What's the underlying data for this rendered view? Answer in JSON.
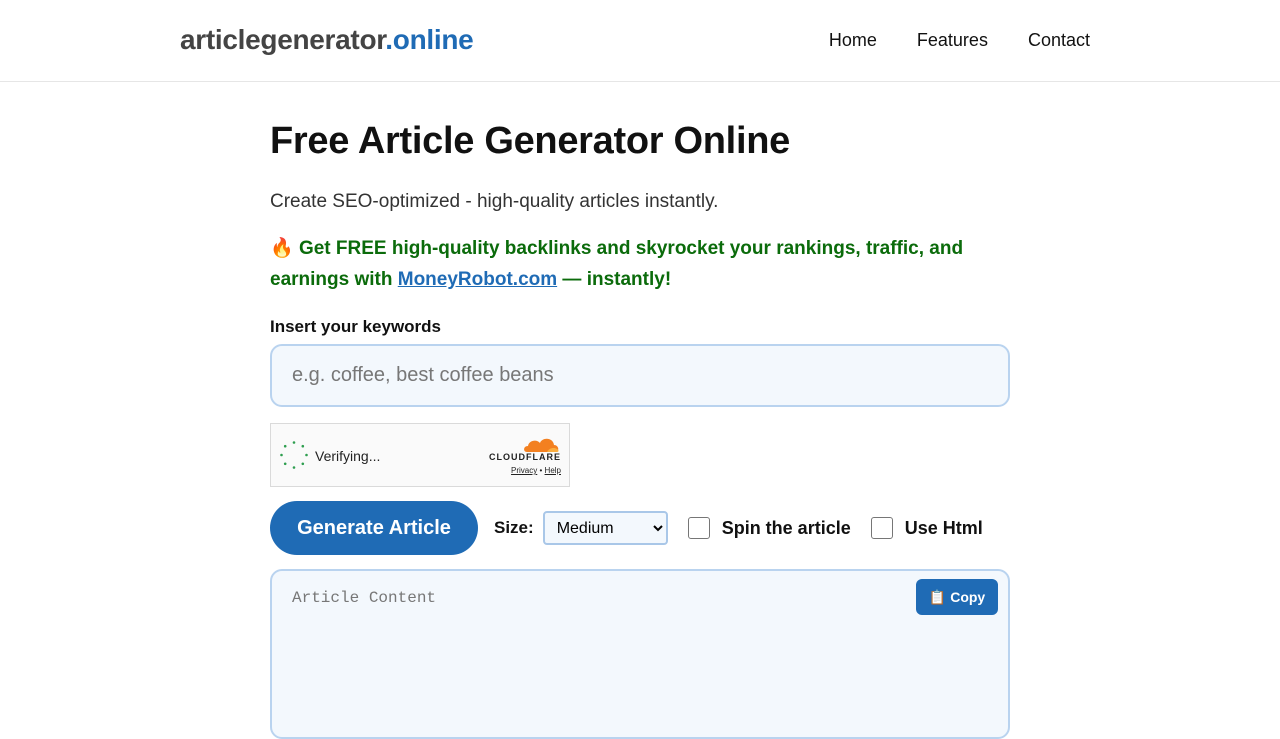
{
  "header": {
    "logo_main": "articlegenerator",
    "logo_tld": ".online",
    "nav": [
      "Home",
      "Features",
      "Contact"
    ]
  },
  "main": {
    "title": "Free Article Generator Online",
    "subtitle": "Create SEO-optimized - high-quality articles instantly.",
    "promo_icon": "🔥",
    "promo_text_before": "Get FREE high-quality backlinks and skyrocket your rankings, traffic, and earnings with",
    "promo_link": "MoneyRobot.com",
    "promo_text_after": "— instantly!",
    "keywords_label": "Insert your keywords",
    "keywords_placeholder": "e.g. coffee, best coffee beans",
    "keywords_value": ""
  },
  "captcha": {
    "status": "Verifying...",
    "brand": "CLOUDFLARE",
    "privacy": "Privacy",
    "separator": "•",
    "help": "Help"
  },
  "controls": {
    "generate_label": "Generate Article",
    "size_label": "Size:",
    "size_selected": "Medium",
    "spin_label": "Spin the article",
    "html_label": "Use Html"
  },
  "article": {
    "placeholder": "Article Content",
    "copy_icon": "📋",
    "copy_label": "Copy"
  },
  "colors": {
    "accent": "#1f6bb5",
    "promo": "#0b6b0b",
    "field_bg": "#f3f8fd",
    "field_border": "#b9d3ef",
    "cloudflare_orange": "#f38020"
  }
}
